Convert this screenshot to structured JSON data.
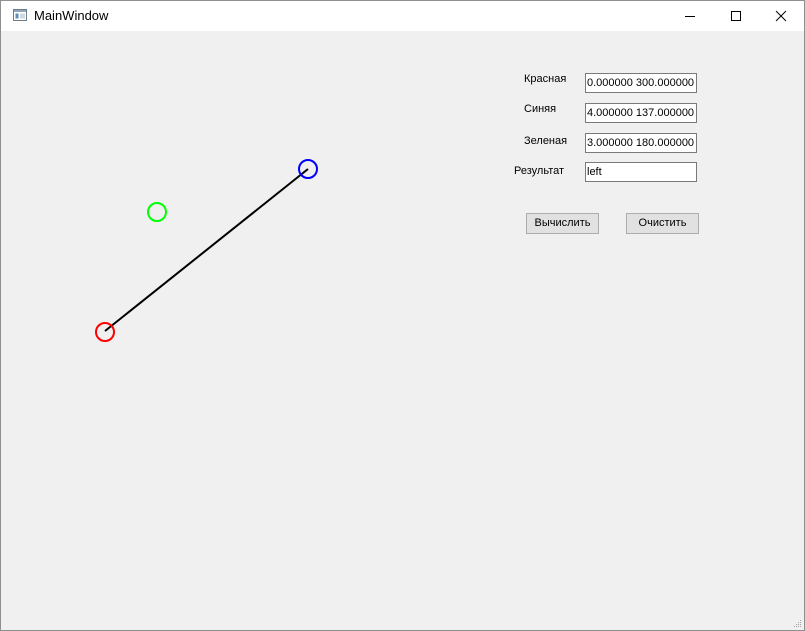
{
  "window": {
    "title": "MainWindow"
  },
  "icons": {
    "app": "app-window-icon",
    "minimize": "minimize-icon",
    "maximize": "maximize-icon",
    "close": "close-icon",
    "resize": "resize-grip-icon"
  },
  "form": {
    "red_label": "Красная",
    "red_value": "0.000000 300.000000",
    "blue_label": "Синяя",
    "blue_value": "4.000000 137.000000",
    "green_label": "Зеленая",
    "green_value": "3.000000 180.000000",
    "result_label": "Результат",
    "result_value": "left",
    "calculate_label": "Вычислить",
    "clear_label": "Очистить"
  },
  "colors": {
    "red_point": "#ff0000",
    "blue_point": "#0000ff",
    "green_point": "#00ff00",
    "segment": "#000000"
  }
}
